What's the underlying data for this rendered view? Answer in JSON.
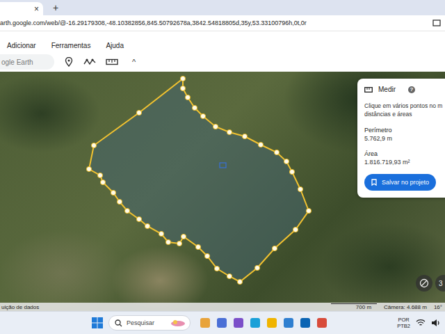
{
  "browser": {
    "tab_close": "×",
    "new_tab": "+",
    "url": "arth.google.com/web/@-16.29179308,-48.10382856,845.50792678a,3842.54818805d,35y,53.33100796h,0t,0r"
  },
  "menu": [
    "Adicionar",
    "Ferramentas",
    "Ajuda"
  ],
  "search": {
    "placeholder": "ogle Earth"
  },
  "toolbar_caret": "^",
  "measure_panel": {
    "title": "Medir",
    "help": "?",
    "hint": [
      "Clique em vários pontos no m",
      "distâncias e áreas"
    ],
    "perimeter_label": "Perímetro",
    "perimeter": "5.762,9 m",
    "area_label": "Área",
    "area": "1.816.719,93 m²",
    "save_button": "Salvar no projeto"
  },
  "map_controls": {
    "three_d": "3"
  },
  "status_bar": {
    "attribution": "uição de dados",
    "scale": "700 m",
    "camera": "Câmera: 4.688 m",
    "tilt": "16°"
  },
  "taskbar": {
    "search_placeholder": "Pesquisar",
    "language": [
      "POR",
      "PTB2"
    ]
  }
}
